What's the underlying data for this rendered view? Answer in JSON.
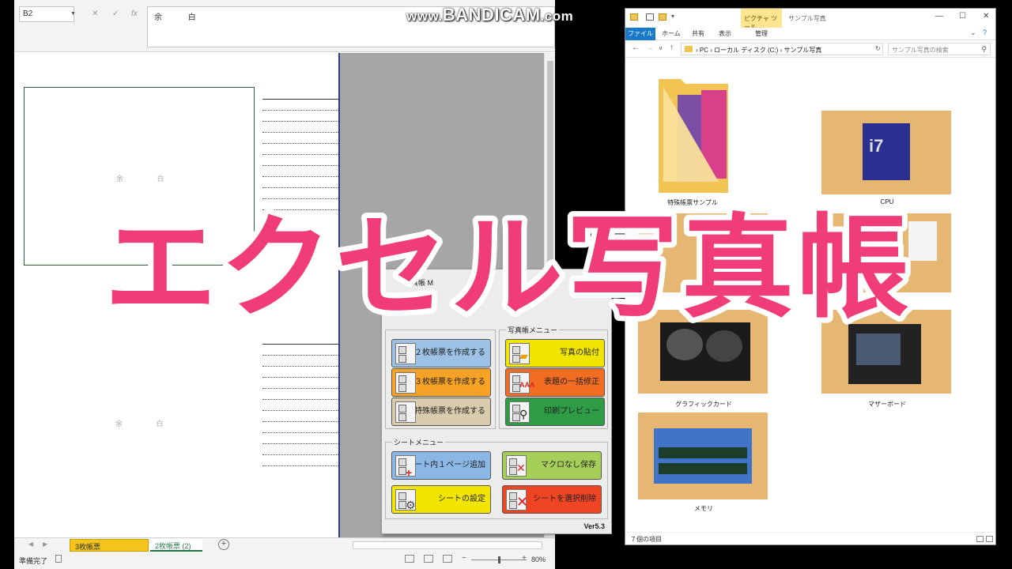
{
  "watermark": {
    "prefix": "www.",
    "brand": "BANDICAM",
    "suffix": ".com"
  },
  "overlay_title": "エクセル写真帳",
  "excel": {
    "namebox": "B2",
    "formula_value": "余 白",
    "photo_placeholder": "余 白",
    "sheet_tabs": [
      "3枚帳票 (DEFSHEET)",
      "2枚帳票 (2)"
    ],
    "status_ready": "準備完了",
    "zoom": "80%"
  },
  "menu": {
    "title": "写真帳 M",
    "groups": {
      "ledger": "",
      "photo": "写真帳メニュー",
      "sheet": "シートメニュー"
    },
    "buttons": [
      {
        "label": "２枚帳票を作成する",
        "color": "#9cc3e6"
      },
      {
        "label": "写真の貼付",
        "color": "#f2e600"
      },
      {
        "label": "３枚帳票を作成する",
        "color": "#f8a324"
      },
      {
        "label": "表題の一括修正",
        "color": "#f26d21"
      },
      {
        "label": "特殊帳票を作成する",
        "color": "#d8ccad"
      },
      {
        "label": "印刷プレビュー",
        "color": "#2e9b45"
      },
      {
        "label": "シート内１ページ追加",
        "color": "#8ab7e6"
      },
      {
        "label": "マクロなし保存",
        "color": "#a6cf5a"
      },
      {
        "label": "シートの設定",
        "color": "#f2e600"
      },
      {
        "label": "シートを選択削除",
        "color": "#ef4523"
      }
    ],
    "version": "Ver5.3"
  },
  "explorer": {
    "tool_tab": "ピクチャ ツール",
    "window_title": "サンプル写真",
    "ribbon_tabs": [
      "ファイル",
      "ホーム",
      "共有",
      "表示",
      "管理"
    ],
    "address": [
      "PC",
      "ローカル ディスク (C:)",
      "サンプル写真"
    ],
    "search_placeholder": "サンプル写真の検索",
    "items": [
      {
        "label": "特殊帳票サンプル",
        "icon": "folder-icon"
      },
      {
        "label": "CPU",
        "icon": "photo-cpu"
      },
      {
        "label": "",
        "icon": "photo"
      },
      {
        "label": "",
        "icon": "photo"
      },
      {
        "label": "グラフィックカード",
        "icon": "photo-gpu"
      },
      {
        "label": "マザーボード",
        "icon": "photo-motherboard"
      },
      {
        "label": "メモリ",
        "icon": "photo-memory"
      }
    ],
    "item_count": "７個の項目"
  }
}
